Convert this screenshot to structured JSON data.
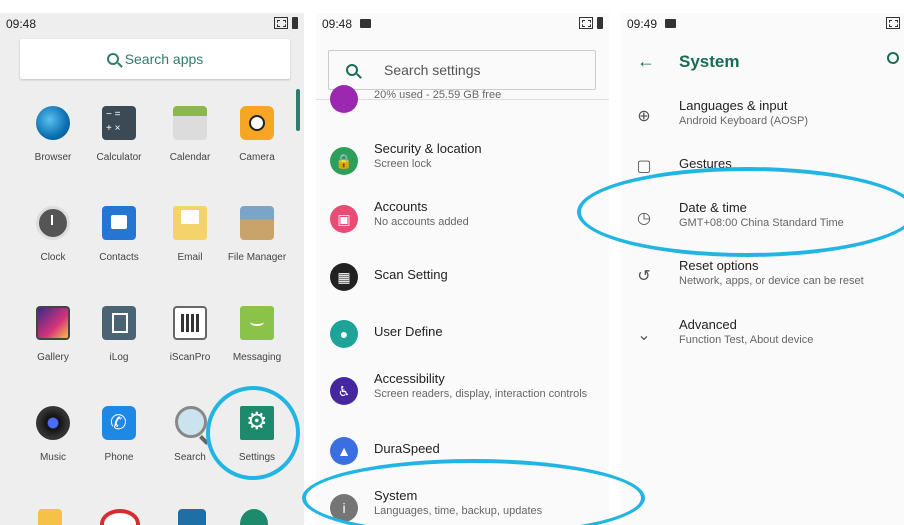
{
  "screen1": {
    "time": "09:48",
    "search_label": "Search apps",
    "apps": [
      {
        "label": "Browser",
        "icon": "browser-icon",
        "cls": "browser"
      },
      {
        "label": "Calculator",
        "icon": "calculator-icon",
        "cls": "calc"
      },
      {
        "label": "Calendar",
        "icon": "calendar-icon",
        "cls": "calendar"
      },
      {
        "label": "Camera",
        "icon": "camera-icon",
        "cls": "camera"
      },
      {
        "label": "Clock",
        "icon": "clock-icon",
        "cls": "clock"
      },
      {
        "label": "Contacts",
        "icon": "contacts-icon",
        "cls": "contacts"
      },
      {
        "label": "Email",
        "icon": "email-icon",
        "cls": "email"
      },
      {
        "label": "File Manager",
        "icon": "file-manager-icon",
        "cls": "filemgr"
      },
      {
        "label": "Gallery",
        "icon": "gallery-icon",
        "cls": "gallery"
      },
      {
        "label": "iLog",
        "icon": "ilog-icon",
        "cls": "ilog"
      },
      {
        "label": "iScanPro",
        "icon": "iscanpro-icon",
        "cls": "iscanpro"
      },
      {
        "label": "Messaging",
        "icon": "messaging-icon",
        "cls": "messaging"
      },
      {
        "label": "Music",
        "icon": "music-icon",
        "cls": "music"
      },
      {
        "label": "Phone",
        "icon": "phone-icon",
        "cls": "phone"
      },
      {
        "label": "Search",
        "icon": "search-app-icon",
        "cls": "search"
      },
      {
        "label": "Settings",
        "icon": "settings-icon",
        "cls": "settings"
      }
    ]
  },
  "screen2": {
    "time": "09:48",
    "search_placeholder": "Search settings",
    "items": [
      {
        "title": "",
        "subtitle": "20% used - 25.59 GB free",
        "icon": "storage-icon",
        "color": "#9c27b0",
        "glyph": ""
      },
      {
        "title": "Security & location",
        "subtitle": "Screen lock",
        "icon": "lock-icon",
        "color": "#2e9e5b",
        "glyph": "🔒"
      },
      {
        "title": "Accounts",
        "subtitle": "No accounts added",
        "icon": "account-icon",
        "color": "#e84b73",
        "glyph": "▣"
      },
      {
        "title": "Scan Setting",
        "subtitle": "",
        "icon": "qr-scan-icon",
        "color": "#222222",
        "glyph": "▦"
      },
      {
        "title": "User Define",
        "subtitle": "",
        "icon": "user-define-icon",
        "color": "#1da398",
        "glyph": "●"
      },
      {
        "title": "Accessibility",
        "subtitle": "Screen readers, display, interaction controls",
        "icon": "accessibility-icon",
        "color": "#4527a0",
        "glyph": "♿"
      },
      {
        "title": "DuraSpeed",
        "subtitle": "",
        "icon": "duraspeed-icon",
        "color": "#3b6ee0",
        "glyph": "▲"
      },
      {
        "title": "System",
        "subtitle": "Languages, time, backup, updates",
        "icon": "info-icon",
        "color": "#757575",
        "glyph": "i"
      }
    ]
  },
  "screen3": {
    "time": "09:49",
    "title": "System",
    "items": [
      {
        "title": "Languages & input",
        "subtitle": "Android Keyboard (AOSP)",
        "icon": "globe-icon",
        "glyph": "⊕"
      },
      {
        "title": "Gestures",
        "subtitle": "",
        "icon": "gestures-icon",
        "glyph": "▢"
      },
      {
        "title": "Date & time",
        "subtitle": "GMT+08:00 China Standard Time",
        "icon": "clock-icon",
        "glyph": "◷"
      },
      {
        "title": "Reset options",
        "subtitle": "Network, apps, or device can be reset",
        "icon": "reset-icon",
        "glyph": "↺"
      },
      {
        "title": "Advanced",
        "subtitle": "Function Test, About device",
        "icon": "chevron-down-icon",
        "glyph": "⌄"
      }
    ]
  },
  "colors": {
    "accent": "#1a6b54",
    "highlight_ring": "#22b5e3"
  }
}
